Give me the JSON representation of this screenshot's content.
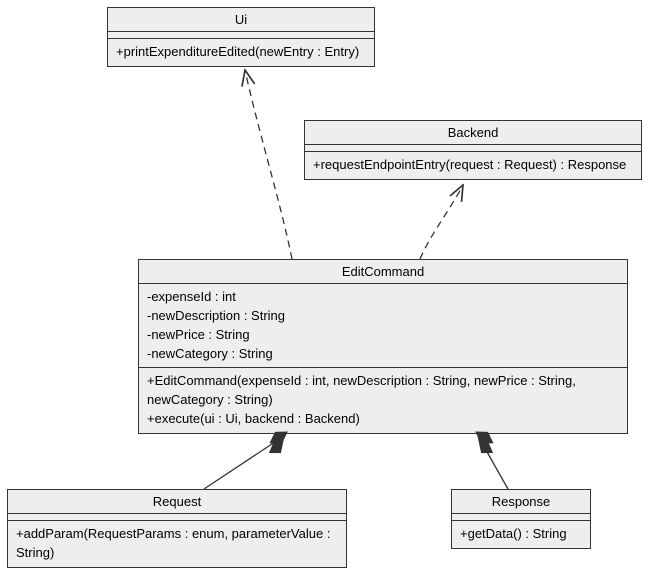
{
  "classes": {
    "ui": {
      "name": "Ui",
      "methods": [
        "+printExpenditureEdited(newEntry : Entry)"
      ]
    },
    "backend": {
      "name": "Backend",
      "methods": [
        "+requestEndpointEntry(request : Request) : Response"
      ]
    },
    "editcommand": {
      "name": "EditCommand",
      "attributes": [
        "-expenseId : int",
        "-newDescription : String",
        "-newPrice : String",
        "-newCategory : String"
      ],
      "methods": [
        "+EditCommand(expenseId : int, newDescription : String, newPrice : String, newCategory : String)",
        "+execute(ui : Ui, backend : Backend)"
      ]
    },
    "request": {
      "name": "Request",
      "methods": [
        "+addParam(RequestParams : enum, parameterValue : String)"
      ]
    },
    "response": {
      "name": "Response",
      "methods": [
        "+getData() : String"
      ]
    }
  },
  "relationships": [
    {
      "from": "EditCommand",
      "to": "Ui",
      "type": "dependency"
    },
    {
      "from": "EditCommand",
      "to": "Backend",
      "type": "dependency"
    },
    {
      "from": "Request",
      "to": "EditCommand",
      "type": "composition"
    },
    {
      "from": "Response",
      "to": "EditCommand",
      "type": "composition"
    }
  ],
  "chart_data": {
    "type": "uml-class-diagram",
    "classes": [
      {
        "name": "Ui",
        "attributes": [],
        "methods": [
          "+printExpenditureEdited(newEntry : Entry)"
        ]
      },
      {
        "name": "Backend",
        "attributes": [],
        "methods": [
          "+requestEndpointEntry(request : Request) : Response"
        ]
      },
      {
        "name": "EditCommand",
        "attributes": [
          "-expenseId : int",
          "-newDescription : String",
          "-newPrice : String",
          "-newCategory : String"
        ],
        "methods": [
          "+EditCommand(expenseId : int, newDescription : String, newPrice : String, newCategory : String)",
          "+execute(ui : Ui, backend : Backend)"
        ]
      },
      {
        "name": "Request",
        "attributes": [],
        "methods": [
          "+addParam(RequestParams : enum, parameterValue : String)"
        ]
      },
      {
        "name": "Response",
        "attributes": [],
        "methods": [
          "+getData() : String"
        ]
      }
    ],
    "relationships": [
      {
        "from": "EditCommand",
        "to": "Ui",
        "type": "dependency"
      },
      {
        "from": "EditCommand",
        "to": "Backend",
        "type": "dependency"
      },
      {
        "from": "Request",
        "to": "EditCommand",
        "type": "composition"
      },
      {
        "from": "Response",
        "to": "EditCommand",
        "type": "composition"
      }
    ]
  }
}
